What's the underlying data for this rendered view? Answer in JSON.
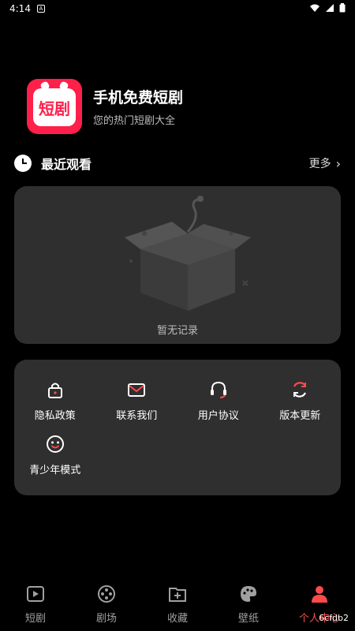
{
  "status_bar": {
    "time": "4:14",
    "left_icon": "A",
    "wifi_icon": "wifi-icon",
    "signal_icon": "signal-icon",
    "battery_icon": "battery-icon"
  },
  "app": {
    "logo_text": "短剧",
    "title": "手机免费短剧",
    "subtitle": "您的热门短剧大全"
  },
  "recent": {
    "title": "最近观看",
    "more_label": "更多",
    "empty_text": "暂无记录"
  },
  "menu": {
    "items": [
      {
        "label": "隐私政策",
        "icon": "lock-icon"
      },
      {
        "label": "联系我们",
        "icon": "mail-icon"
      },
      {
        "label": "用户协议",
        "icon": "headset-icon"
      },
      {
        "label": "版本更新",
        "icon": "refresh-icon"
      },
      {
        "label": "青少年模式",
        "icon": "smile-icon"
      }
    ]
  },
  "bottom_nav": {
    "items": [
      {
        "label": "短剧",
        "icon": "play-icon"
      },
      {
        "label": "剧场",
        "icon": "film-reel-icon"
      },
      {
        "label": "收藏",
        "icon": "add-folder-icon"
      },
      {
        "label": "壁纸",
        "icon": "palette-icon"
      },
      {
        "label": "个人中心",
        "icon": "user-icon",
        "active": true
      }
    ],
    "overlay_text": "6cfdb2"
  },
  "colors": {
    "accent": "#ff4a4a",
    "brand": "#ff1f4b",
    "card_bg": "#2f2f2f",
    "background": "#000000"
  }
}
